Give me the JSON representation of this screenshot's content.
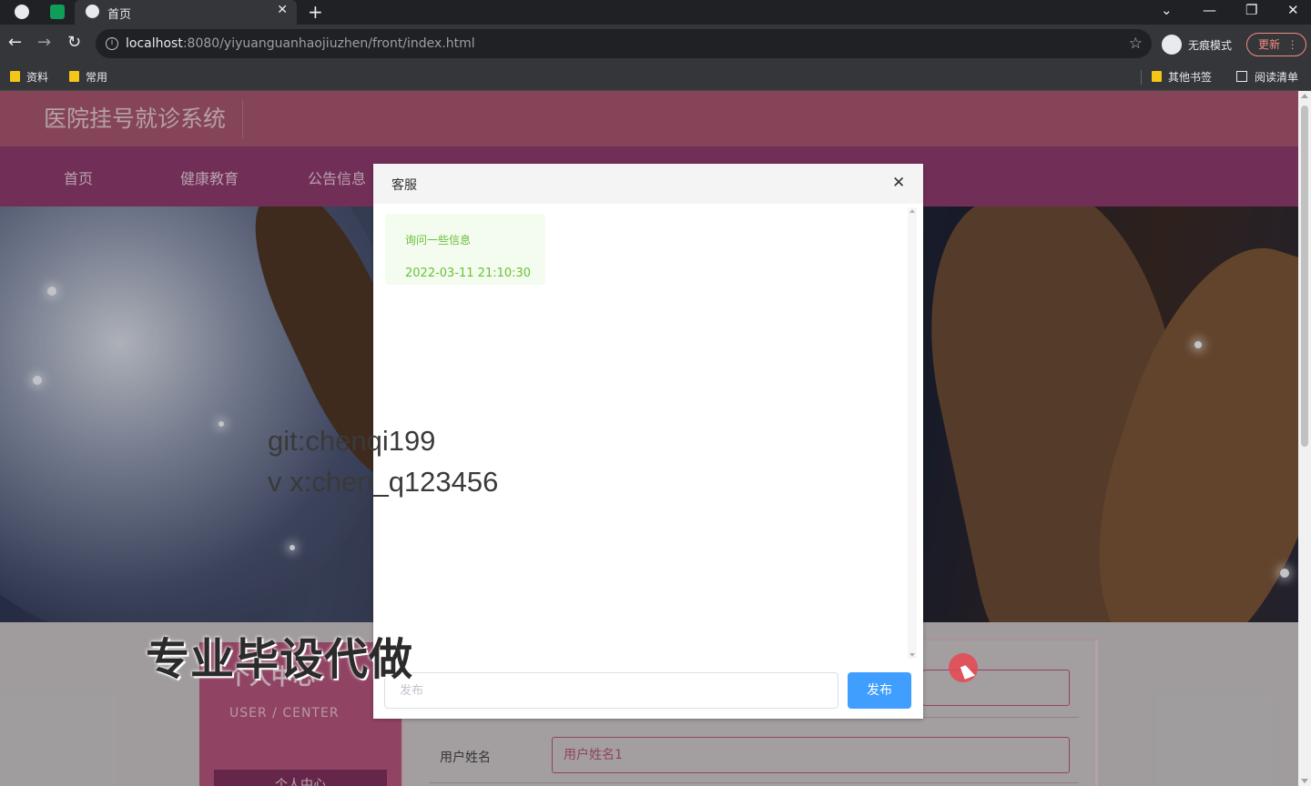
{
  "browser": {
    "tab": {
      "title": "首页",
      "close": "✕"
    },
    "new_tab": "+",
    "window_controls": {
      "tabs_menu": "⌄",
      "minimize": "—",
      "restore": "❐",
      "close": "✕"
    },
    "address": {
      "host": "localhost",
      "rest": ":8080/yiyuanguanhaojiuzhen/front/index.html"
    },
    "incognito_label": "无痕模式",
    "update_label": "更新",
    "bookmarks": [
      "资料",
      "常用"
    ],
    "bookmarks_right": {
      "other": "其他书签",
      "reading": "阅读清单"
    }
  },
  "site": {
    "title": "医院挂号就诊系统",
    "nav": [
      "首页",
      "健康教育",
      "公告信息"
    ]
  },
  "user_center": {
    "title": "个人中心",
    "subtitle": "USER / CENTER",
    "button": "个人中心"
  },
  "form": {
    "name_label": "用户姓名",
    "name_value": "用户姓名1"
  },
  "dialog": {
    "title": "客服",
    "close": "✕",
    "messages": [
      {
        "text": "询问一些信息",
        "time": "2022-03-11 21:10:30"
      }
    ],
    "input_placeholder": "发布",
    "send_label": "发布"
  },
  "watermarks": {
    "line1": "git:chenqi199",
    "line2": "v x:chen_q123456",
    "banner": "专业毕设代做"
  }
}
